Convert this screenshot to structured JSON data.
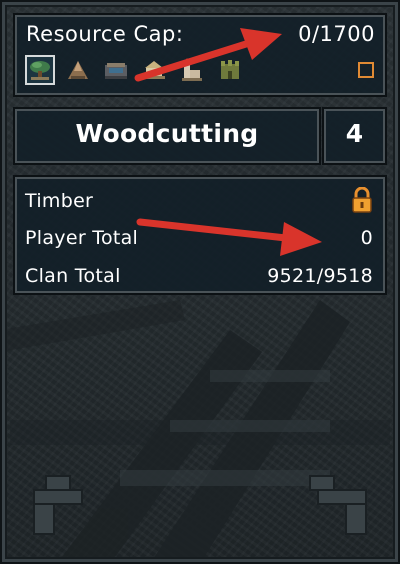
{
  "resource_cap": {
    "label": "Resource Cap:",
    "value": "0/1700",
    "skill_icons": [
      {
        "icon": "woodcutting-icon",
        "selected": true
      },
      {
        "icon": "mining-icon",
        "selected": false
      },
      {
        "icon": "fishing-icon",
        "selected": false
      },
      {
        "icon": "farming-icon",
        "selected": false
      },
      {
        "icon": "hunter-icon",
        "selected": false
      },
      {
        "icon": "construction-icon",
        "selected": false
      }
    ],
    "checkbox_checked": false
  },
  "skill": {
    "name": "Woodcutting",
    "level": "4"
  },
  "resource": {
    "name": "Timber",
    "locked": true,
    "player_total_label": "Player Total",
    "player_total_value": "0",
    "clan_total_label": "Clan Total",
    "clan_total_value": "9521/9518"
  },
  "colors": {
    "panel_bg": "#122028",
    "panel_border": "#4a5358",
    "accent_orange": "#e08a34",
    "annotation_arrow": "#d9342b"
  }
}
